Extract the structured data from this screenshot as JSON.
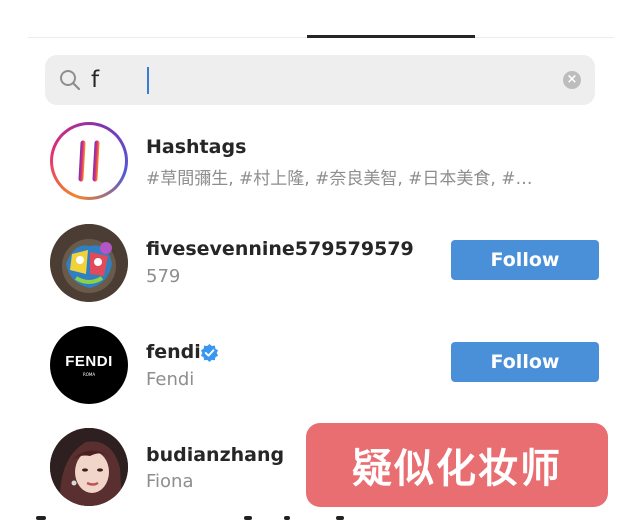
{
  "search": {
    "value": "f",
    "icon": "search-icon",
    "clear_icon": "clear-icon"
  },
  "results": [
    {
      "type": "hashtag",
      "title": "Hashtags",
      "subtitle": "#草間彌生, #村上隆, #奈良美智, #日本美食, #…",
      "icon": "hashtag-icon"
    },
    {
      "type": "user",
      "title": "fivesevennine579579579",
      "subtitle": "579",
      "action": "Follow"
    },
    {
      "type": "user",
      "title": "fendi",
      "subtitle": "Fendi",
      "action": "Follow",
      "verified": true,
      "avatar_text": "FENDI",
      "avatar_subtext": "ROMA"
    },
    {
      "type": "user",
      "title": "budianzhang",
      "subtitle": "Fiona"
    }
  ],
  "overlay": {
    "watermark_text": "疑似化妆师",
    "partial_hidden": "F"
  },
  "colors": {
    "accent": "#4a90d9",
    "watermark": "#e96e72",
    "verified": "#3897f0"
  }
}
